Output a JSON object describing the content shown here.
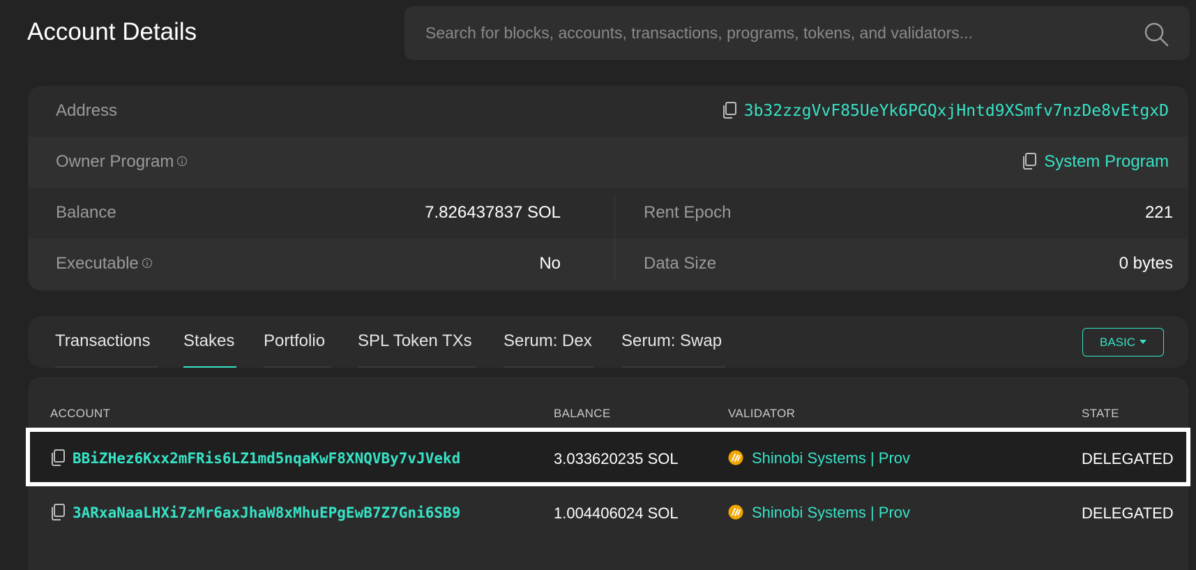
{
  "header": {
    "title": "Account Details",
    "search_placeholder": "Search for blocks, accounts, transactions, programs, tokens, and validators..."
  },
  "details": {
    "address_label": "Address",
    "address_value": "3b32zzgVvF85UeYk6PGQxjHntd9XSmfv7nzDe8vEtgxD",
    "owner_label": "Owner Program",
    "owner_value": "System Program",
    "balance_label": "Balance",
    "balance_value": "7.826437837 SOL",
    "rent_epoch_label": "Rent Epoch",
    "rent_epoch_value": "221",
    "executable_label": "Executable",
    "executable_value": "No",
    "data_size_label": "Data Size",
    "data_size_value": "0 bytes"
  },
  "tabs": {
    "items": [
      "Transactions",
      "Stakes",
      "Portfolio",
      "SPL Token TXs",
      "Serum: Dex",
      "Serum: Swap"
    ],
    "active": "Stakes",
    "mode_button": "BASIC"
  },
  "stakes_table": {
    "headers": [
      "ACCOUNT",
      "BALANCE",
      "VALIDATOR",
      "STATE"
    ],
    "rows": [
      {
        "account": "BBiZHez6Kxx2mFRis6LZ1md5nqaKwF8XNQVBy7vJVekd",
        "balance": "3.033620235 SOL",
        "validator": "Shinobi Systems | Prov",
        "state": "DELEGATED"
      },
      {
        "account": "3ARxaNaaLHXi7zMr6axJhaW8xMhuEPgEwB7Z7Gni6SB9",
        "balance": "1.004406024 SOL",
        "validator": "Shinobi Systems | Prov",
        "state": "DELEGATED"
      }
    ]
  },
  "colors": {
    "accent": "#37e3c6",
    "background": "#232323",
    "card": "#2b2b2b"
  }
}
